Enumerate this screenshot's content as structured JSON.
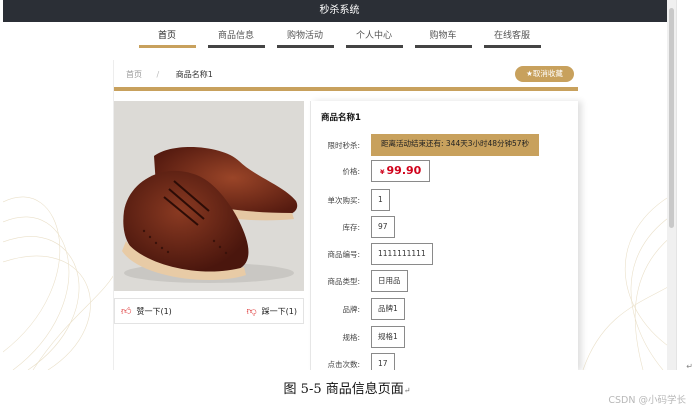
{
  "app": {
    "title": "秒杀系统"
  },
  "nav": {
    "items": [
      {
        "label": "首页",
        "active": true
      },
      {
        "label": "商品信息",
        "active": false
      },
      {
        "label": "购物活动",
        "active": false
      },
      {
        "label": "个人中心",
        "active": false
      },
      {
        "label": "购物车",
        "active": false
      },
      {
        "label": "在线客服",
        "active": false
      }
    ]
  },
  "breadcrumb": {
    "home": "首页",
    "separator": "/",
    "current": "商品名称1"
  },
  "favorite": {
    "icon": "star-icon",
    "label": "★取消收藏"
  },
  "product": {
    "name": "商品名称1",
    "image_alt": "brown leather brogue shoes",
    "vote_up": "赞一下(1)",
    "vote_down": "踩一下(1)",
    "fields": [
      {
        "label": "限时秒杀:",
        "value": "距离活动结束还有: 344天3小时48分钟57秒",
        "kind": "flash"
      },
      {
        "label": "价格:",
        "value": "99.90",
        "currency": "¥",
        "kind": "price"
      },
      {
        "label": "单次购买:",
        "value": "1",
        "kind": "plain"
      },
      {
        "label": "库存:",
        "value": "97",
        "kind": "plain"
      },
      {
        "label": "商品编号:",
        "value": "1111111111",
        "kind": "plain"
      },
      {
        "label": "商品类型:",
        "value": "日用品",
        "kind": "plain"
      },
      {
        "label": "品牌:",
        "value": "品牌1",
        "kind": "plain"
      },
      {
        "label": "规格:",
        "value": "规格1",
        "kind": "plain"
      },
      {
        "label": "点击次数:",
        "value": "17",
        "kind": "plain"
      }
    ]
  },
  "caption": {
    "text": "图 5-5 商品信息页面",
    "mark": "↵"
  },
  "watermark": "CSDN @小码学长",
  "colors": {
    "accent": "#c8a15d",
    "topbar": "#2b2f36",
    "price": "#d0021b"
  }
}
